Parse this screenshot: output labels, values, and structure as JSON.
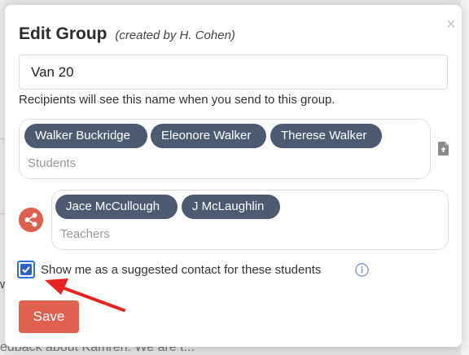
{
  "background": {
    "row_letter": "w",
    "row_text": "edback about Kamren. We are t..."
  },
  "modal": {
    "title": "Edit Group",
    "subtitle": "(created by H. Cohen)",
    "close_glyph": "×",
    "group_name_value": "Van 20",
    "group_name_help": "Recipients will see this name when you send to this group.",
    "students": {
      "pills": [
        "Walker Buckridge",
        "Eleonore Walker",
        "Therese Walker"
      ],
      "placeholder": "Students"
    },
    "teachers": {
      "pills": [
        "Jace McCullough",
        "J McLaughlin"
      ],
      "placeholder": "Teachers"
    },
    "suggested_contact": {
      "label": "Show me as a suggested contact for these students",
      "checked": true
    },
    "save_label": "Save"
  },
  "icons": {
    "close": "close-icon",
    "upload": "upload-file-icon",
    "share": "share-icon",
    "check": "check-icon",
    "info": "info-icon",
    "annotation": "red-arrow-annotation"
  },
  "colors": {
    "pill_bg": "#4c5a72",
    "accent_red": "#e0604f",
    "checkbox_blue": "#2f62c8",
    "annotation_red": "#e8231f"
  }
}
